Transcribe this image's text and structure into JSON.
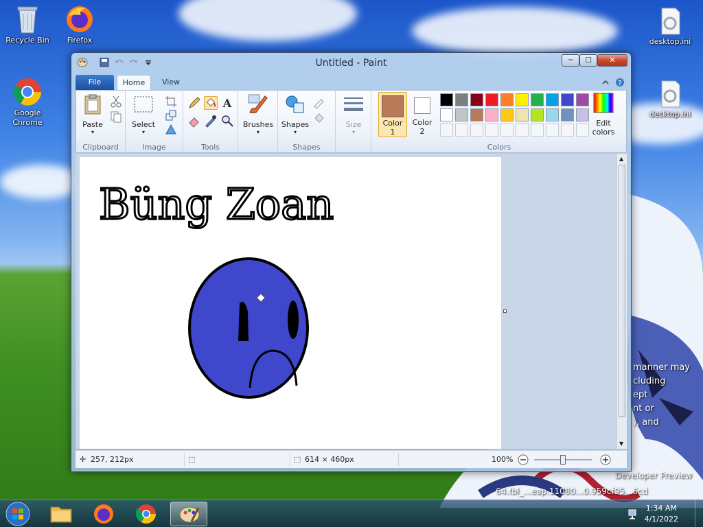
{
  "desktop": {
    "icons": {
      "recycle_bin": "Recycle Bin",
      "firefox": "Firefox",
      "chrome": "Google Chrome",
      "desktop_ini_1": "desktop.ini",
      "desktop_ini_2": "desktop.ini"
    },
    "watermark": {
      "line1": "manner may",
      "line2": "cluding",
      "line3": "ept",
      "line4": "nt or",
      "line5": "), and",
      "developer": "Developer Preview",
      "build": "64.fbl_...eap.11080...0.959cf95...6cd"
    }
  },
  "window": {
    "title": "Untitled - Paint",
    "controls": {
      "minimize": "─",
      "maximize": "☐",
      "close": "✕"
    },
    "tabs": {
      "file": "File",
      "home": "Home",
      "view": "View"
    }
  },
  "ribbon": {
    "clipboard": {
      "paste": "Paste",
      "group": "Clipboard"
    },
    "image": {
      "select": "Select",
      "group": "Image"
    },
    "tools": {
      "group": "Tools"
    },
    "brushes": {
      "label": "Brushes"
    },
    "shapes": {
      "label": "Shapes",
      "group": "Shapes"
    },
    "size": {
      "label": "Size"
    },
    "colors": {
      "color1_label": "Color",
      "color1_num": "1",
      "color2_label": "Color",
      "color2_num": "2",
      "edit_label": "Edit",
      "edit_label2": "colors",
      "group": "Colors",
      "color1_value": "#b97a57",
      "color2_value": "#ffffff",
      "row1": [
        "#000000",
        "#7f7f7f",
        "#880015",
        "#ed1c24",
        "#ff7f27",
        "#fff200",
        "#22b14c",
        "#00a2e8",
        "#3f48cc",
        "#a349a4"
      ],
      "row2": [
        "#ffffff",
        "#c3c3c3",
        "#b97a57",
        "#ffaec9",
        "#ffc90e",
        "#efe4b0",
        "#b5e61d",
        "#99d9ea",
        "#7092be",
        "#c8bfe7"
      ]
    }
  },
  "drawing": {
    "text": "Büng Zoan",
    "face_color": "#3f48cc"
  },
  "status": {
    "cursor_pos": "257, 212px",
    "canvas_size": "614 × 460px",
    "zoom": "100%"
  },
  "taskbar": {
    "time": "1:34 AM",
    "date": "4/1/2022"
  }
}
